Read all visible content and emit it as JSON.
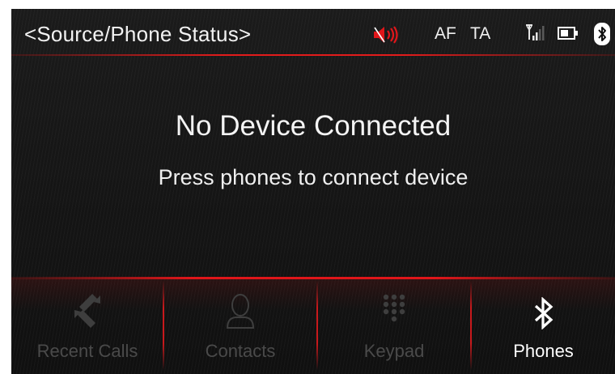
{
  "header": {
    "title": "<Source/Phone Status>",
    "af": "AF",
    "ta": "TA",
    "icons": [
      "speaker-muted-icon",
      "signal-icon",
      "battery-icon",
      "bluetooth-icon"
    ]
  },
  "message": {
    "main": "No Device Connected",
    "sub": "Press phones to connect device"
  },
  "tabs": [
    {
      "label": "Recent Calls",
      "icon": "recent-calls-icon",
      "enabled": false
    },
    {
      "label": "Contacts",
      "icon": "contacts-icon",
      "enabled": false
    },
    {
      "label": "Keypad",
      "icon": "keypad-icon",
      "enabled": false
    },
    {
      "label": "Phones",
      "icon": "bluetooth-icon",
      "enabled": true
    }
  ],
  "colors": {
    "accent": "#e21b1b",
    "text": "#f2f2f2",
    "disabled": "#4a4a4a",
    "background": "#161616"
  }
}
